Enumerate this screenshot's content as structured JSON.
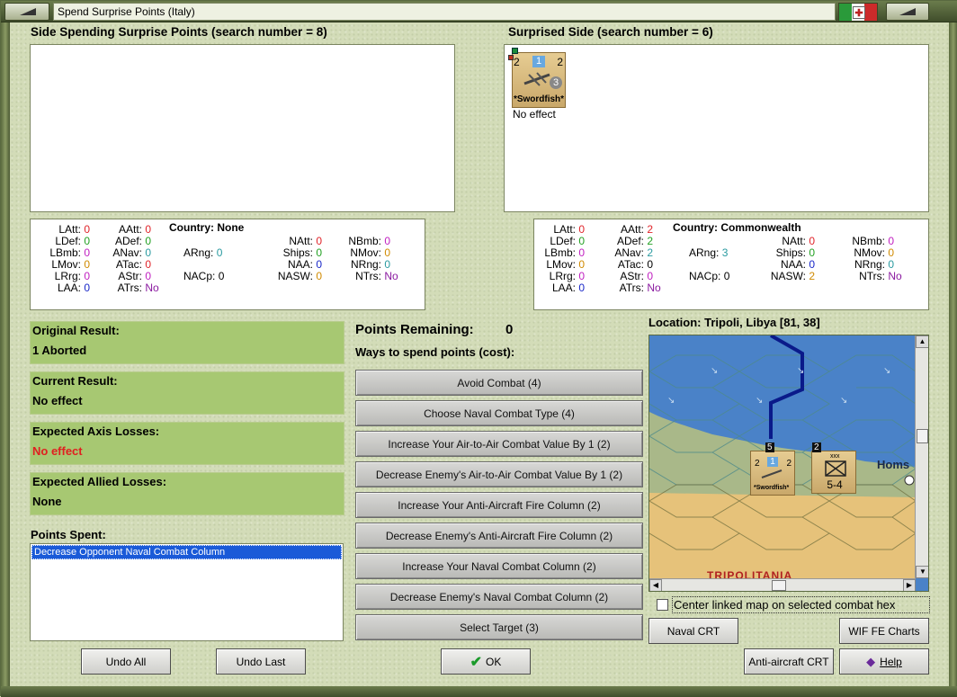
{
  "window": {
    "title": "Spend Surprise Points (Italy)"
  },
  "left_side": {
    "heading": "Side Spending Surprise Points (search number = 8)",
    "stats": {
      "country": "Country: None",
      "LAtt": "0",
      "LDef": "0",
      "LBmb": "0",
      "LMov": "0",
      "LRrg": "0",
      "LAA": "0",
      "AAtt": "0",
      "ADef": "0",
      "ANav": "0",
      "ATac": "0",
      "AStr": "0",
      "ATrs": "No",
      "ARng": "0",
      "NACp": "0",
      "NAtt": "0",
      "Ships": "0",
      "NAA": "0",
      "NASW": "0",
      "NBmb": "0",
      "NMov": "0",
      "NRng": "0",
      "NTrs": "No"
    }
  },
  "right_side": {
    "heading": "Surprised Side (search number = 6)",
    "unit": {
      "name": "*Swordfish*",
      "left_value": "2",
      "center_value": "1",
      "right_value": "2",
      "bottom_value": "3",
      "result": "No effect"
    },
    "stats": {
      "country": "Country: Commonwealth",
      "LAtt": "0",
      "LDef": "0",
      "LBmb": "0",
      "LMov": "0",
      "LRrg": "0",
      "LAA": "0",
      "AAtt": "2",
      "ADef": "2",
      "ANav": "2",
      "ATac": "0",
      "AStr": "0",
      "ATrs": "No",
      "ARng": "3",
      "NACp": "0",
      "NAtt": "0",
      "Ships": "0",
      "NAA": "0",
      "NASW": "2",
      "NBmb": "0",
      "NMov": "0",
      "NRng": "0",
      "NTrs": "No"
    }
  },
  "results": {
    "original_label": "Original Result:",
    "original_value": "1 Aborted",
    "current_label": "Current Result:",
    "current_value": "No effect",
    "axis_label": "Expected Axis Losses:",
    "axis_value": "No effect",
    "allied_label": "Expected Allied Losses:",
    "allied_value": "None"
  },
  "points_spent": {
    "label": "Points Spent:",
    "items": [
      "Decrease Opponent Naval Combat Column"
    ]
  },
  "points": {
    "remaining_label": "Points Remaining:",
    "remaining_value": "0",
    "ways_label": "Ways to spend points (cost):",
    "options": [
      "Avoid Combat (4)",
      "Choose Naval Combat Type (4)",
      "Increase Your Air-to-Air Combat Value By 1 (2)",
      "Decrease Enemy's Air-to-Air Combat Value By 1 (2)",
      "Increase Your Anti-Aircraft Fire Column (2)",
      "Decrease Enemy's Anti-Aircraft Fire Column (2)",
      "Increase Your Naval Combat Column (2)",
      "Decrease Enemy's Naval Combat Column (2)",
      "Select Target (3)"
    ]
  },
  "map": {
    "location": "Location: Tripoli, Libya [81, 38]",
    "town": "Homs",
    "region": "TRIPOLITANIA",
    "land_unit": {
      "value": "5-4",
      "stack": "2",
      "corps": "xxx"
    },
    "air_stack": "5",
    "center_checkbox_label": "Center linked map on selected combat hex",
    "center_checked": false
  },
  "buttons": {
    "undo_all": "Undo All",
    "undo_last": "Undo Last",
    "ok": "OK",
    "naval_crt": "Naval CRT",
    "wif_fe_charts": "WIF FE Charts",
    "aa_crt": "Anti-aircraft CRT",
    "help": "Help"
  },
  "colors": {
    "zero": "#e0242a",
    "green_val": "#22a022",
    "purple": "#c020c0",
    "blue": "#1a28c8",
    "cyan": "#2a9aa0",
    "orange": "#d08a00",
    "panel": "#a7c872",
    "sea": "#4a82c8",
    "land": "#e6c27a",
    "loss_red": "#e02020"
  }
}
